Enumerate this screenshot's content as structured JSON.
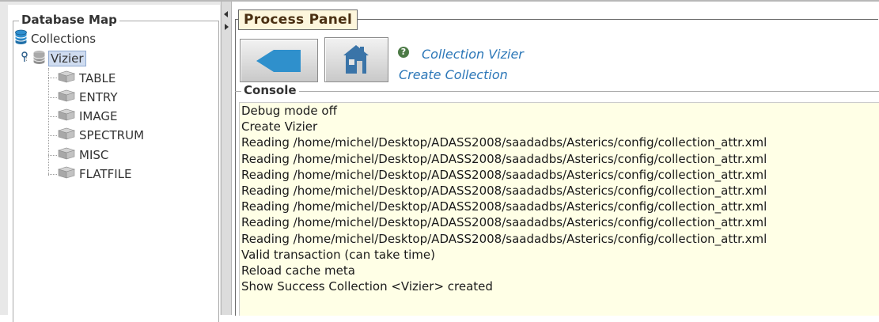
{
  "database_map": {
    "title": "Database Map",
    "root": {
      "label": "Collections",
      "icon": "database-stack-icon"
    },
    "collection": {
      "label": "Vizier",
      "icon": "database-icon",
      "selected": true
    },
    "categories": [
      {
        "label": "TABLE",
        "icon": "cube-icon"
      },
      {
        "label": "ENTRY",
        "icon": "cube-icon"
      },
      {
        "label": "IMAGE",
        "icon": "cube-icon"
      },
      {
        "label": "SPECTRUM",
        "icon": "cube-icon"
      },
      {
        "label": "MISC",
        "icon": "cube-icon"
      },
      {
        "label": "FLATFILE",
        "icon": "cube-icon"
      }
    ]
  },
  "process_panel": {
    "title": "Process Panel",
    "buttons": {
      "back_icon": "back-arrow-icon",
      "home_icon": "home-icon"
    },
    "info_icon": "info-icon",
    "nav_title": "Collection Vizier",
    "nav_subtitle": "Create Collection"
  },
  "console": {
    "title": "Console",
    "lines": [
      "Debug mode off",
      "Create Vizier",
      "Reading /home/michel/Desktop/ADASS2008/saadadbs/Asterics/config/collection_attr.xml",
      "Reading /home/michel/Desktop/ADASS2008/saadadbs/Asterics/config/collection_attr.xml",
      "Reading /home/michel/Desktop/ADASS2008/saadadbs/Asterics/config/collection_attr.xml",
      "Reading /home/michel/Desktop/ADASS2008/saadadbs/Asterics/config/collection_attr.xml",
      "Reading /home/michel/Desktop/ADASS2008/saadadbs/Asterics/config/collection_attr.xml",
      "Reading /home/michel/Desktop/ADASS2008/saadadbs/Asterics/config/collection_attr.xml",
      "Reading /home/michel/Desktop/ADASS2008/saadadbs/Asterics/config/collection_attr.xml",
      "Valid transaction (can take time)",
      "Reload cache meta",
      "Show Success Collection <Vizier> created"
    ]
  },
  "colors": {
    "console_background": "#ffffe6",
    "nav_text": "#2c77b8",
    "back_arrow": "#2f90cc",
    "home_icon": "#3a74a8",
    "panel_title_bg": "#fdf6dc",
    "selection_bg": "#cfdcf0"
  }
}
